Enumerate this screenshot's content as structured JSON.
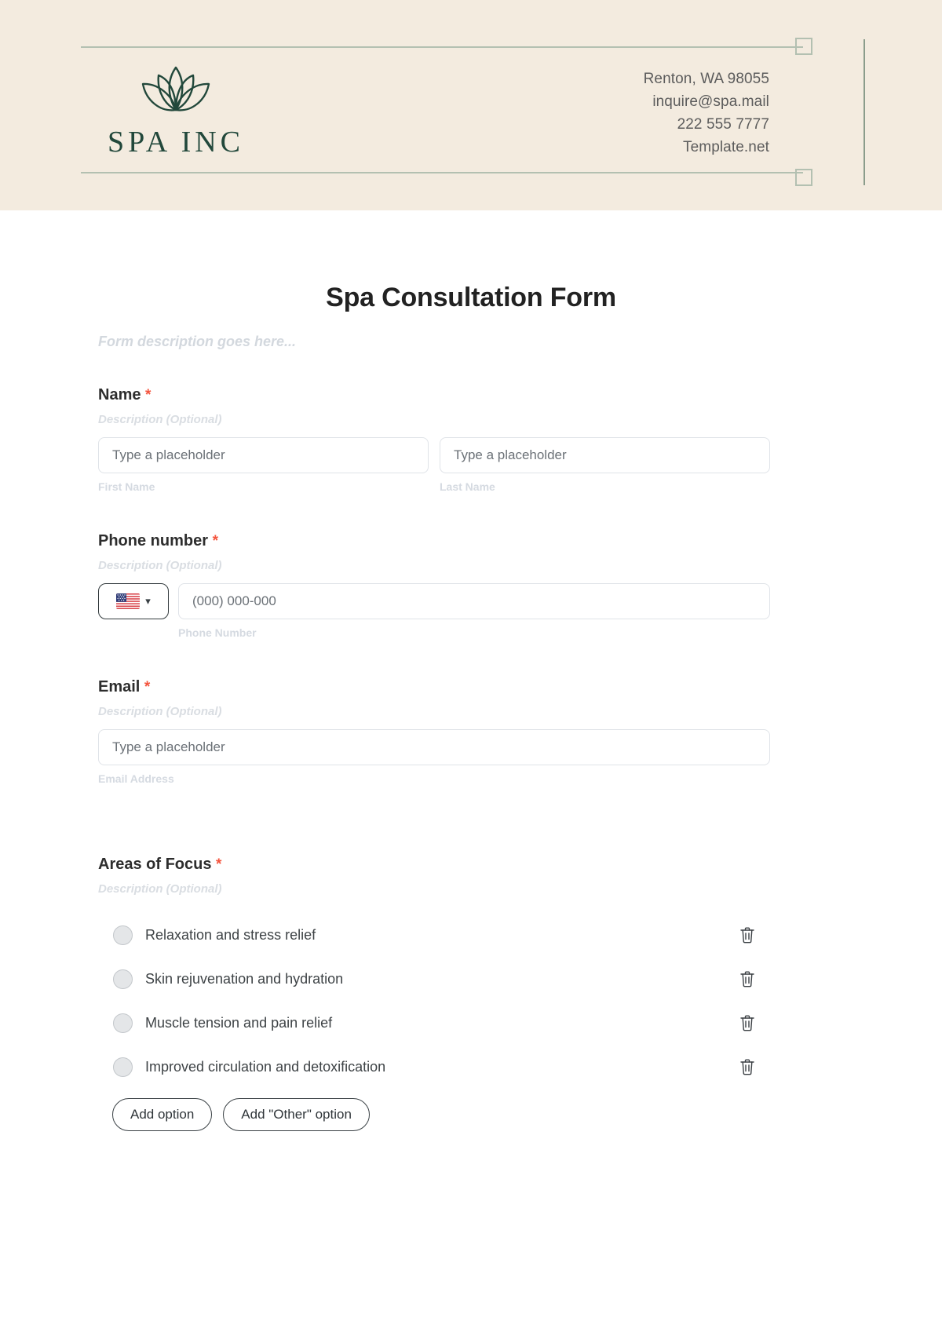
{
  "letterhead": {
    "logo_text": "SPA INC",
    "logo_icon": "lotus-icon",
    "contact": [
      "Renton, WA 98055",
      "inquire@spa.mail",
      "222 555 7777",
      "Template.net"
    ]
  },
  "form": {
    "title": "Spa Consultation Form",
    "description": "Form description goes here...",
    "required_marker": "*",
    "optional_description": "Description (Optional)",
    "placeholder": "Type a placeholder",
    "fields": {
      "name": {
        "label": "Name",
        "first": {
          "placeholder": "Type a placeholder",
          "sub_label": "First Name"
        },
        "last": {
          "placeholder": "Type a placeholder",
          "sub_label": "Last Name"
        }
      },
      "phone": {
        "label": "Phone number",
        "country_code_flag": "us-flag-icon",
        "placeholder": "(000) 000-000",
        "sub_label": "Phone Number"
      },
      "email": {
        "label": "Email",
        "placeholder": "Type a placeholder",
        "sub_label": "Email Address"
      },
      "areas_of_focus": {
        "label": "Areas of Focus",
        "options": [
          "Relaxation and stress relief",
          "Skin rejuvenation and hydration",
          "Muscle tension and pain relief",
          "Improved circulation and detoxification"
        ],
        "add_option_label": "Add option",
        "add_other_label": "Add \"Other\" option"
      }
    }
  },
  "colors": {
    "header_bg": "#f3ebdf",
    "brand_green": "#22483b",
    "rule_green": "#b3c0b1",
    "required_red": "#f4543d"
  }
}
